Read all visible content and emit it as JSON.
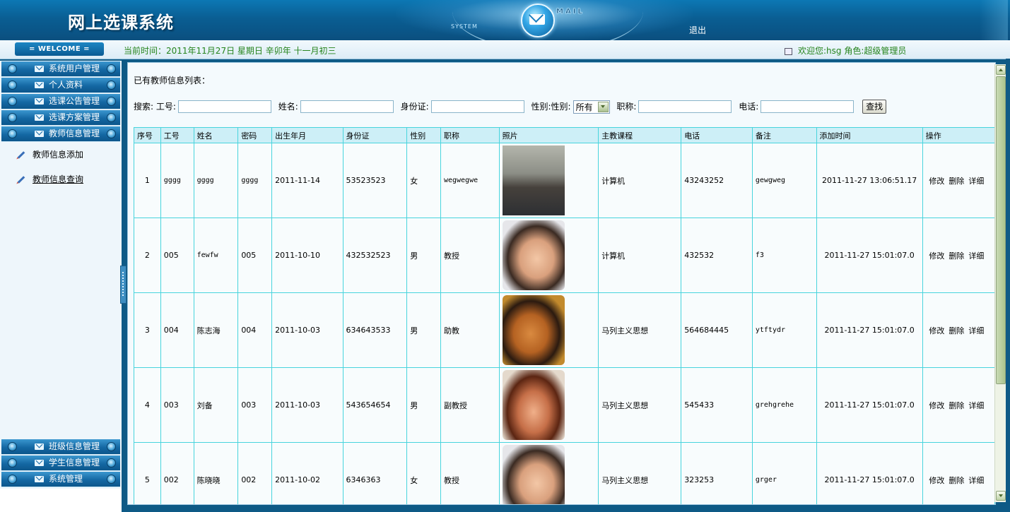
{
  "header": {
    "title": "网上选课系统",
    "system_tag": "SYSTEM",
    "mail_tag": "MAIL",
    "logout_label": "退出"
  },
  "statusbar": {
    "welcome": "= WELCOME =",
    "current_time": "当前时间：2011年11月27日 星期日 辛卯年 十一月初三",
    "user_info": "欢迎您:hsg 角色:超级管理员"
  },
  "sidebar": {
    "top_items": [
      {
        "label": "系统用户管理"
      },
      {
        "label": "个人资料"
      },
      {
        "label": "选课公告管理"
      },
      {
        "label": "选课方案管理"
      },
      {
        "label": "教师信息管理"
      }
    ],
    "sub_items": [
      {
        "label": "教师信息添加"
      },
      {
        "label": "教师信息查询"
      }
    ],
    "bottom_items": [
      {
        "label": "班级信息管理"
      },
      {
        "label": "学生信息管理"
      },
      {
        "label": "系统管理"
      }
    ]
  },
  "main": {
    "list_title": "已有教师信息列表：",
    "search": {
      "prefix": "搜索:",
      "id_label": "工号:",
      "name_label": "姓名:",
      "idcard_label": "身份证:",
      "gender_label": "性别:性别:",
      "gender_value": "所有",
      "title_label": "职称:",
      "phone_label": "电话:",
      "button_label": "查找"
    },
    "table": {
      "columns": [
        "序号",
        "工号",
        "姓名",
        "密码",
        "出生年月",
        "身份证",
        "性别",
        "职称",
        "照片",
        "主教课程",
        "电话",
        "备注",
        "添加时间",
        "操作"
      ],
      "rows": [
        {
          "no": "1",
          "id": "gggg",
          "name": "gggg",
          "pwd": "gggg",
          "birth": "2011-11-14",
          "idcard": "53523523",
          "gender": "女",
          "title": "wegwegwe",
          "course": "计算机",
          "phone": "43243252",
          "note": "gewgweg",
          "added": "2011-11-27 13:06:51.17"
        },
        {
          "no": "2",
          "id": "005",
          "name": "fewfw",
          "pwd": "005",
          "birth": "2011-10-10",
          "idcard": "432532523",
          "gender": "男",
          "title": "教授",
          "course": "计算机",
          "phone": "432532",
          "note": "f3",
          "added": "2011-11-27 15:01:07.0"
        },
        {
          "no": "3",
          "id": "004",
          "name": "陈志海",
          "pwd": "004",
          "birth": "2011-10-03",
          "idcard": "634643533",
          "gender": "男",
          "title": "助教",
          "course": "马列主义思想",
          "phone": "564684445",
          "note": "ytftydr",
          "added": "2011-11-27 15:01:07.0"
        },
        {
          "no": "4",
          "id": "003",
          "name": "刘备",
          "pwd": "003",
          "birth": "2011-10-03",
          "idcard": "543654654",
          "gender": "男",
          "title": "副教授",
          "course": "马列主义思想",
          "phone": "545433",
          "note": "grehgrehe",
          "added": "2011-11-27 15:01:07.0"
        },
        {
          "no": "5",
          "id": "002",
          "name": "陈晓晓",
          "pwd": "002",
          "birth": "2011-10-02",
          "idcard": "6346363",
          "gender": "女",
          "title": "教授",
          "course": "马列主义思想",
          "phone": "323253",
          "note": "grger",
          "added": "2011-11-27 15:01:07.0"
        }
      ],
      "ops": {
        "edit": "修改",
        "delete": "删除",
        "detail": "详细"
      }
    }
  }
}
